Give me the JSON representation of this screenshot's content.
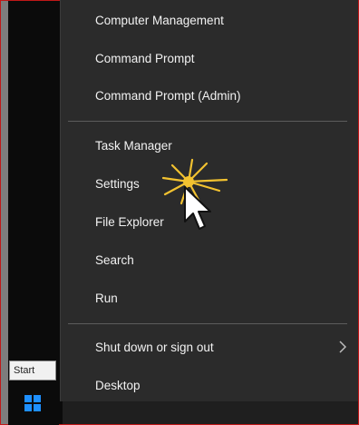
{
  "menu": {
    "items": [
      {
        "label": "Computer Management"
      },
      {
        "label": "Command Prompt"
      },
      {
        "label": "Command Prompt (Admin)"
      },
      {
        "label": "Task Manager"
      },
      {
        "label": "Settings"
      },
      {
        "label": "File Explorer"
      },
      {
        "label": "Search"
      },
      {
        "label": "Run"
      },
      {
        "label": "Shut down or sign out"
      },
      {
        "label": "Desktop"
      }
    ]
  },
  "taskbar": {
    "start_tooltip": "Start",
    "start_icon": "windows-logo-icon"
  },
  "colors": {
    "menu_bg": "#2b2b2b",
    "text": "#f2f2f2",
    "separator": "#5c5c5c",
    "frame_border": "#c01818",
    "start_logo": "#1e90ff",
    "highlight_spark": "#f2c230"
  }
}
